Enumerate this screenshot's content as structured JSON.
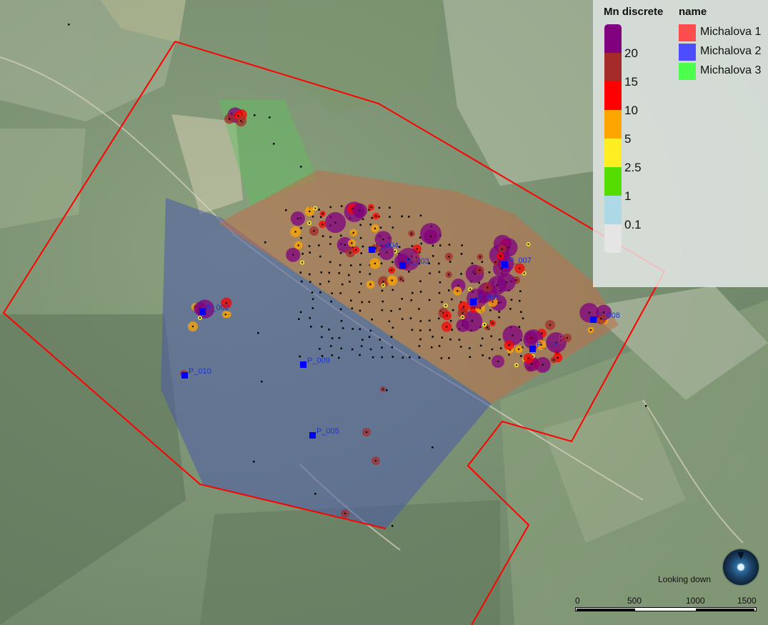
{
  "legend": {
    "mn_title": "Mn discrete",
    "name_title": "name",
    "mn_classes": [
      {
        "label": "20",
        "color": "#800080"
      },
      {
        "label": "15",
        "color": "#a52a2a"
      },
      {
        "label": "10",
        "color": "#ff0000"
      },
      {
        "label": "5",
        "color": "#ffa500"
      },
      {
        "label": "2.5",
        "color": "#ffee22"
      },
      {
        "label": "1",
        "color": "#55dd00"
      },
      {
        "label": "0.1",
        "color": "#add8e6"
      },
      {
        "label": "",
        "color": "#e5e5e5"
      }
    ],
    "names": [
      {
        "label": "Michalova 1",
        "color": "#ff4d4d"
      },
      {
        "label": "Michalova 2",
        "color": "#4d4dff"
      },
      {
        "label": "Michalova 3",
        "color": "#4dff4d"
      }
    ]
  },
  "areas": {
    "michalova_1_color": "#c0704a",
    "michalova_2_color": "#4a5aa8",
    "michalova_3_color": "#5fc25f",
    "boundary_color": "#ff0000"
  },
  "stations": [
    {
      "label": "P_002"
    },
    {
      "label": "P_004"
    },
    {
      "label": "P_003"
    },
    {
      "label": "P_007"
    },
    {
      "label": "P_001"
    },
    {
      "label": "P_008"
    },
    {
      "label": "P_006"
    },
    {
      "label": "P_009"
    },
    {
      "label": "P_010"
    },
    {
      "label": "P_005"
    }
  ],
  "compass": {
    "text": "Looking down"
  },
  "scale": {
    "labels": [
      "0",
      "500",
      "1000",
      "1500"
    ]
  }
}
